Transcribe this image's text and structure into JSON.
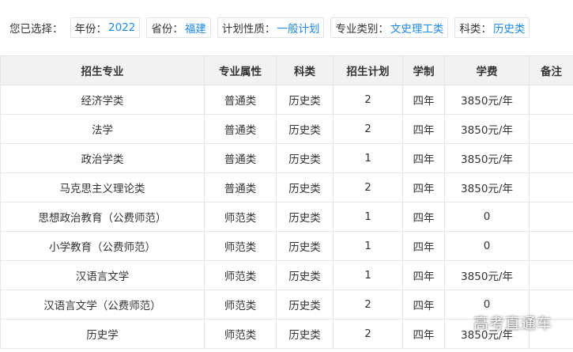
{
  "filters": {
    "label": "您已选择：",
    "chips": [
      {
        "key": "年份：",
        "value": "2022"
      },
      {
        "key": "省份：",
        "value": "福建"
      },
      {
        "key": "计划性质：",
        "value": "一般计划"
      },
      {
        "key": "专业类别：",
        "value": "文史理工类"
      },
      {
        "key": "科类：",
        "value": "历史类"
      }
    ]
  },
  "table": {
    "headers": [
      "招生专业",
      "专业属性",
      "科类",
      "招生计划",
      "学制",
      "学费",
      "备注"
    ],
    "rows": [
      [
        "经济学类",
        "普通类",
        "历史类",
        "2",
        "四年",
        "3850元/年",
        ""
      ],
      [
        "法学",
        "普通类",
        "历史类",
        "2",
        "四年",
        "3850元/年",
        ""
      ],
      [
        "政治学类",
        "普通类",
        "历史类",
        "1",
        "四年",
        "3850元/年",
        ""
      ],
      [
        "马克思主义理论类",
        "普通类",
        "历史类",
        "2",
        "四年",
        "3850元/年",
        ""
      ],
      [
        "思想政治教育（公费师范）",
        "师范类",
        "历史类",
        "1",
        "四年",
        "0",
        ""
      ],
      [
        "小学教育（公费师范）",
        "师范类",
        "历史类",
        "1",
        "四年",
        "0",
        ""
      ],
      [
        "汉语言文学",
        "师范类",
        "历史类",
        "1",
        "四年",
        "3850元/年",
        ""
      ],
      [
        "汉语言文学（公费师范）",
        "师范类",
        "历史类",
        "2",
        "四年",
        "0",
        ""
      ],
      [
        "历史学",
        "师范类",
        "历史类",
        "2",
        "四年",
        "3850元/年",
        ""
      ]
    ]
  },
  "watermark": "高考直通车"
}
